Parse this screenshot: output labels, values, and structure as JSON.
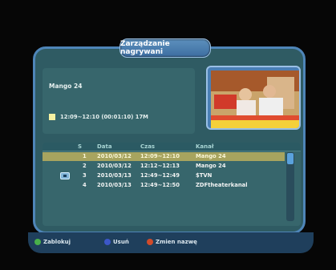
{
  "window": {
    "title": "Zarządzanie nagrywani"
  },
  "info": {
    "channel": "Mango 24",
    "time_range": "12:09~12:10 (00:01:10) 17M"
  },
  "list": {
    "headers": {
      "no": "S",
      "date": "Data",
      "time": "Czas",
      "channel": "Kanał"
    },
    "rows": [
      {
        "no": "1",
        "date": "2010/03/12",
        "time": "12:09~12:10",
        "channel": "Mango 24"
      },
      {
        "no": "2",
        "date": "2010/03/12",
        "time": "12:12~12:13",
        "channel": "Mango 24"
      },
      {
        "no": "3",
        "date": "2010/03/13",
        "time": "12:49~12:49",
        "channel": "$TVN"
      },
      {
        "no": "4",
        "date": "2010/03/13",
        "time": "12:49~12:50",
        "channel": "ZDFtheaterkanal"
      }
    ],
    "selected_index": 0
  },
  "footer": {
    "lock": {
      "label": "Zablokuj",
      "color": "#49b04a"
    },
    "delete": {
      "label": "Usuń",
      "color": "#3c57c8"
    },
    "rename": {
      "label": "Zmien nazwę",
      "color": "#d24b2a"
    }
  }
}
